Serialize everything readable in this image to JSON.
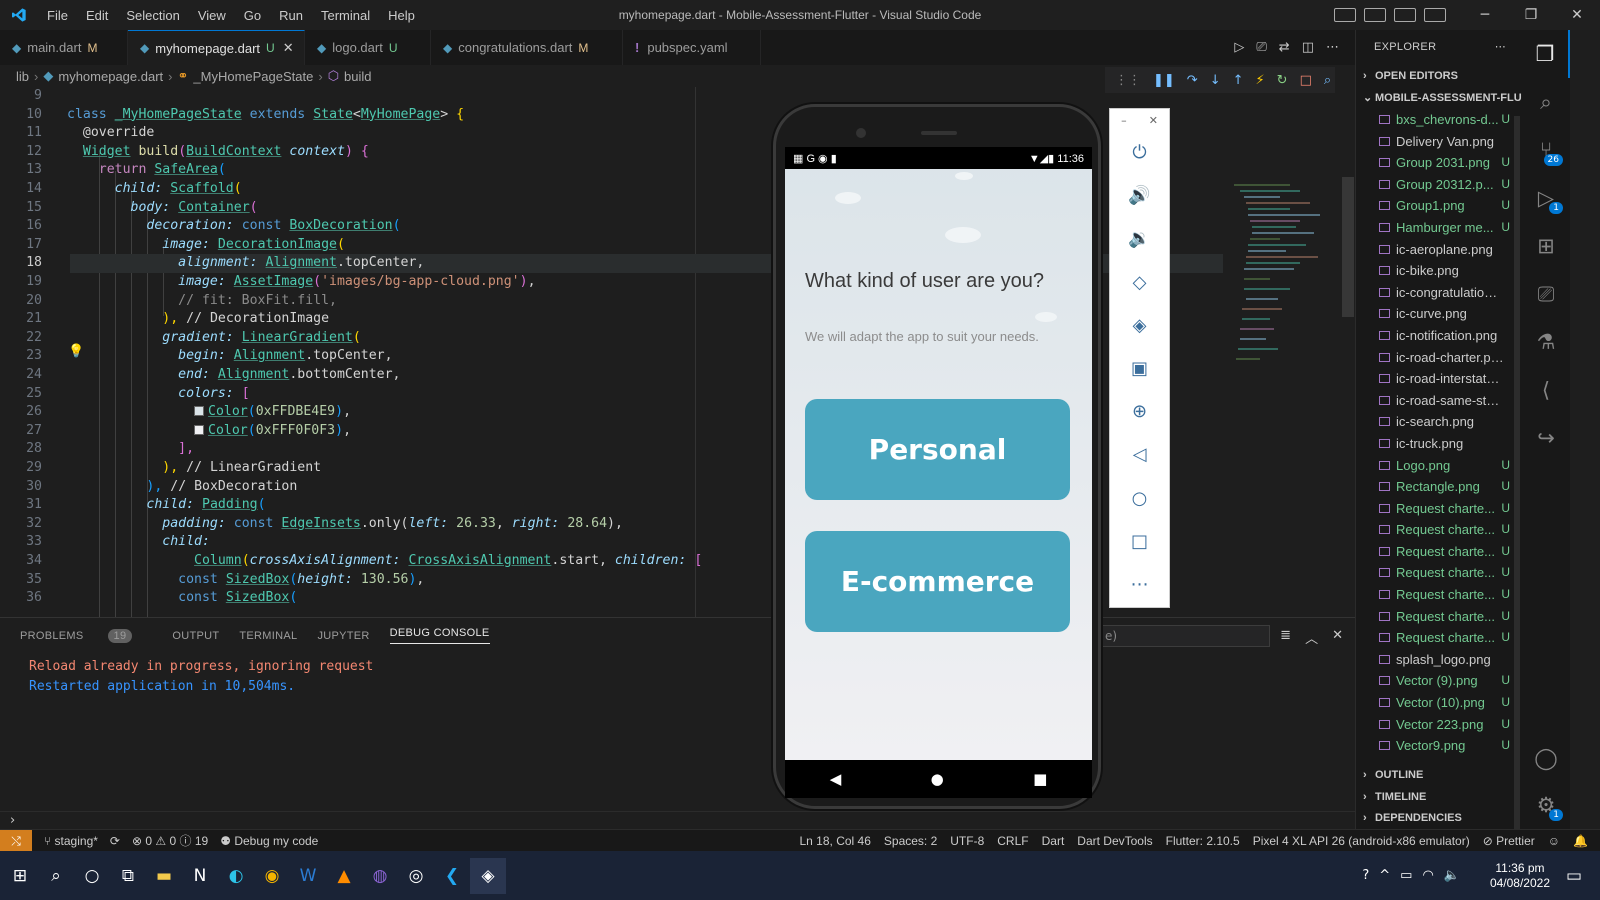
{
  "window": {
    "title": "myhomepage.dart - Mobile-Assessment-Flutter - Visual Studio Code",
    "menu": [
      "File",
      "Edit",
      "Selection",
      "View",
      "Go",
      "Run",
      "Terminal",
      "Help"
    ]
  },
  "tabs": [
    {
      "name": "main.dart",
      "status": "M",
      "active": false
    },
    {
      "name": "myhomepage.dart",
      "status": "U",
      "active": true
    },
    {
      "name": "logo.dart",
      "status": "U",
      "active": false
    },
    {
      "name": "congratulations.dart",
      "status": "M",
      "active": false
    },
    {
      "name": "pubspec.yaml",
      "status": "",
      "active": false
    }
  ],
  "breadcrumb": [
    "lib",
    "myhomepage.dart",
    "_MyHomePageState",
    "build"
  ],
  "editor": {
    "cursor_line": 18,
    "lines": [
      {
        "n": "9"
      },
      {
        "n": "10"
      },
      {
        "n": "11"
      },
      {
        "n": "12"
      },
      {
        "n": "13"
      },
      {
        "n": "14"
      },
      {
        "n": "15"
      },
      {
        "n": "16"
      },
      {
        "n": "17"
      },
      {
        "n": "18"
      },
      {
        "n": "19"
      },
      {
        "n": "20"
      },
      {
        "n": "21"
      },
      {
        "n": "22"
      },
      {
        "n": "23"
      },
      {
        "n": "24"
      },
      {
        "n": "25"
      },
      {
        "n": "26"
      },
      {
        "n": "27"
      },
      {
        "n": "28"
      },
      {
        "n": "29"
      },
      {
        "n": "30"
      },
      {
        "n": "31"
      },
      {
        "n": "32"
      },
      {
        "n": "33"
      },
      {
        "n": "34"
      },
      {
        "n": "35"
      },
      {
        "n": "36"
      }
    ],
    "code": {
      "l10_class": "class",
      "l10_name": "_MyHomePageState",
      "l10_ext": "extends",
      "l10_state": "State",
      "l10_gen": "MyHomePage",
      "l11": "@override",
      "l12_widget": "Widget",
      "l12_build": "build",
      "l12_ctx": "BuildContext",
      "l12_arg": "context",
      "l13_ret": "return",
      "l13_safe": "SafeArea",
      "l14_child": "child:",
      "l14_scaffold": "Scaffold",
      "l15_body": "body:",
      "l15_container": "Container",
      "l16_dec": "decoration:",
      "l16_const": "const",
      "l16_box": "BoxDecoration",
      "l17_image": "image:",
      "l17_decimg": "DecorationImage",
      "l18_align": "alignment:",
      "l18_alignment": "Alignment",
      "l18_top": ".topCenter,",
      "l19_image": "image:",
      "l19_asset": "AssetImage",
      "l19_path": "'images/bg-app-cloud.png'",
      "l20": "// fit: BoxFit.fill,",
      "l21_close": "),",
      "l21_comment": "// DecorationImage",
      "l22_grad": "gradient:",
      "l22_lin": "LinearGradient",
      "l23_begin": "begin:",
      "l23_alignment": "Alignment",
      "l23_top": ".topCenter,",
      "l24_end": "end:",
      "l24_alignment": "Alignment",
      "l24_bottom": ".bottomCenter,",
      "l25_colors": "colors:",
      "l26_color": "Color",
      "l26_val": "0xFFDBE4E9",
      "l27_color": "Color",
      "l27_val": "0xFFF0F0F3",
      "l28": "],",
      "l29_close": "),",
      "l29_comment": "// LinearGradient",
      "l30_close": "),",
      "l30_comment": "// BoxDecoration",
      "l31_child": "child:",
      "l31_pad": "Padding",
      "l32_pad": "padding:",
      "l32_const": "const",
      "l32_edge": "EdgeInsets",
      "l32_only": ".only(",
      "l32_left": "left:",
      "l32_lval": "26.33",
      "l32_right": "right:",
      "l32_rval": "28.64",
      "l33_child": "child:",
      "l34_col": "Column",
      "l34_cross": "crossAxisAlignment:",
      "l34_caa": "CrossAxisAlignment",
      "l34_start": ".start,",
      "l34_children": "children:",
      "l35_const": "const",
      "l35_sized": "SizedBox",
      "l35_height": "height:",
      "l35_val": "130.56",
      "l36_const": "const",
      "l36_sized": "SizedBox"
    }
  },
  "panel": {
    "tabs": [
      "PROBLEMS",
      "OUTPUT",
      "TERMINAL",
      "JUPYTER",
      "DEBUG CONSOLE"
    ],
    "problems_count": "19",
    "filter_text": "e)",
    "lines": [
      {
        "text": "Reload already in progress, ignoring request",
        "color": "#f48771"
      },
      {
        "text": "Restarted application in 10,504ms.",
        "color": "#3794ff"
      }
    ]
  },
  "phone": {
    "time": "11:36",
    "heading": "What kind of user are you?",
    "subtitle": "We will adapt the app to suit your needs.",
    "buttons": [
      "Personal",
      "E-commerce"
    ],
    "button_color": "#4aa6bf"
  },
  "explorer": {
    "header": "EXPLORER",
    "open_editors": "OPEN EDITORS",
    "project": "MOBILE-ASSESSMENT-FLU...",
    "files": [
      {
        "name": "bxs_chevrons-d...",
        "status": "U"
      },
      {
        "name": "Delivery Van.png",
        "status": ""
      },
      {
        "name": "Group 2031.png",
        "status": "U"
      },
      {
        "name": "Group 20312.p...",
        "status": "U"
      },
      {
        "name": "Group1.png",
        "status": "U"
      },
      {
        "name": "Hamburger me...",
        "status": "U"
      },
      {
        "name": "ic-aeroplane.png",
        "status": ""
      },
      {
        "name": "ic-bike.png",
        "status": ""
      },
      {
        "name": "ic-congratulations.p...",
        "status": ""
      },
      {
        "name": "ic-curve.png",
        "status": ""
      },
      {
        "name": "ic-notification.png",
        "status": ""
      },
      {
        "name": "ic-road-charter.png",
        "status": ""
      },
      {
        "name": "ic-road-interstate.png",
        "status": ""
      },
      {
        "name": "ic-road-same-state...",
        "status": ""
      },
      {
        "name": "ic-search.png",
        "status": ""
      },
      {
        "name": "ic-truck.png",
        "status": ""
      },
      {
        "name": "Logo.png",
        "status": "U"
      },
      {
        "name": "Rectangle.png",
        "status": "U"
      },
      {
        "name": "Request charte...",
        "status": "U"
      },
      {
        "name": "Request charte...",
        "status": "U"
      },
      {
        "name": "Request charte...",
        "status": "U"
      },
      {
        "name": "Request charte...",
        "status": "U"
      },
      {
        "name": "Request charte...",
        "status": "U"
      },
      {
        "name": "Request charte...",
        "status": "U"
      },
      {
        "name": "Request charte...",
        "status": "U"
      },
      {
        "name": "splash_logo.png",
        "status": ""
      },
      {
        "name": "Vector (9).png",
        "status": "U"
      },
      {
        "name": "Vector (10).png",
        "status": "U"
      },
      {
        "name": "Vector 223.png",
        "status": "U"
      },
      {
        "name": "Vector9.png",
        "status": "U"
      }
    ],
    "outline": "OUTLINE",
    "timeline": "TIMELINE",
    "dependencies": "DEPENDENCIES"
  },
  "activity_badges": {
    "scm": "26",
    "run": "1",
    "settings": "1"
  },
  "statusbar": {
    "branch": "staging*",
    "errors": "0",
    "warnings": "0",
    "infos": "19",
    "debug": "Debug my code",
    "position": "Ln 18, Col 46",
    "spaces": "Spaces: 2",
    "encoding": "UTF-8",
    "eol": "CRLF",
    "language": "Dart",
    "devtools": "Dart DevTools",
    "flutter": "Flutter: 2.10.5",
    "device": "Pixel 4 XL API 26 (android-x86 emulator)",
    "prettier": "Prettier"
  },
  "taskbar": {
    "time": "11:36 pm",
    "date": "04/08/2022"
  },
  "colors": {
    "accent": "#0078d4",
    "untracked": "#73c991",
    "modified": "#e2c08d"
  }
}
